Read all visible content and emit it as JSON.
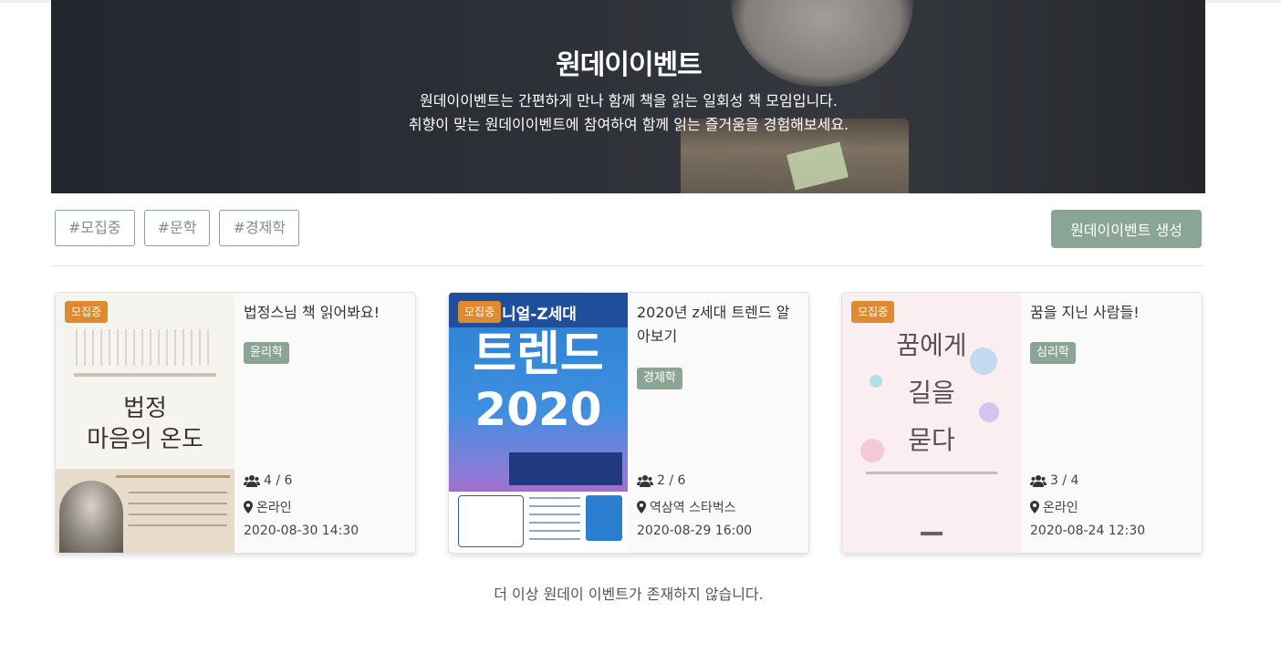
{
  "hero": {
    "title": "원데이이벤트",
    "desc_line1": "원데이이벤트는 간편하게 만나 함께 책을 읽는 일회성 책 모임입니다.",
    "desc_line2": "취향이 맞는 원데이이벤트에 참여하여 함께 읽는 즐거움을 경험해보세요."
  },
  "filters": [
    "#모집중",
    "#문학",
    "#경제학"
  ],
  "create_button": "원데이이벤트 생성",
  "cards": [
    {
      "status": "모집중",
      "title": "법정스님 책 읽어봐요!",
      "category": "윤리학",
      "members": "4 / 6",
      "location": "온라인",
      "datetime": "2020-08-30 14:30",
      "cover": {
        "line1": "법정",
        "line2": "마음의 온도"
      }
    },
    {
      "status": "모집중",
      "title": "2020년 z세대 트렌드 알아보기",
      "category": "경제학",
      "members": "2 / 6",
      "location": "역삼역 스타벅스",
      "datetime": "2020-08-29 16:00",
      "cover": {
        "line1": "트렌드",
        "line2": "2020",
        "band": "니얼-Z세대"
      }
    },
    {
      "status": "모집중",
      "title": "꿈을 지닌 사람들!",
      "category": "심리학",
      "members": "3 / 4",
      "location": "온라인",
      "datetime": "2020-08-24 12:30",
      "cover": {
        "line1": "꿈에게",
        "line2": "길을",
        "line3": "묻다"
      }
    }
  ],
  "empty_message": "더 이상 원데이 이벤트가 존재하지 않습니다.",
  "colors": {
    "accent": "#8aa596",
    "status": "#e08a2f"
  },
  "icons": {
    "members": "users-icon",
    "location": "map-marker-icon"
  }
}
